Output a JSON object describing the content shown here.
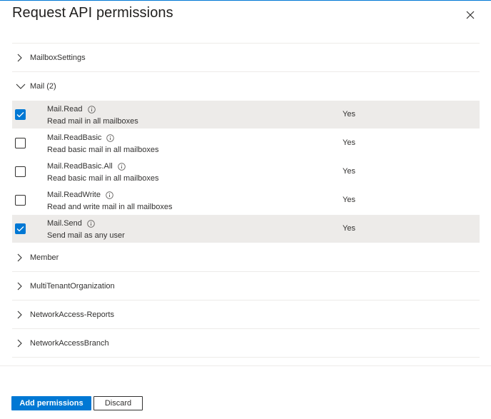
{
  "panel": {
    "title": "Request API permissions",
    "close_icon": "close-icon"
  },
  "groups_before": [
    {
      "label": "MailboxSettings",
      "expanded": false
    }
  ],
  "expanded_group": {
    "label": "Mail (2)",
    "expanded": true,
    "permissions": [
      {
        "name": "Mail.Read",
        "description": "Read mail in all mailboxes",
        "admin_consent": "Yes",
        "checked": true
      },
      {
        "name": "Mail.ReadBasic",
        "description": "Read basic mail in all mailboxes",
        "admin_consent": "Yes",
        "checked": false
      },
      {
        "name": "Mail.ReadBasic.All",
        "description": "Read basic mail in all mailboxes",
        "admin_consent": "Yes",
        "checked": false
      },
      {
        "name": "Mail.ReadWrite",
        "description": "Read and write mail in all mailboxes",
        "admin_consent": "Yes",
        "checked": false
      },
      {
        "name": "Mail.Send",
        "description": "Send mail as any user",
        "admin_consent": "Yes",
        "checked": true
      }
    ]
  },
  "groups_after": [
    {
      "label": "Member",
      "expanded": false
    },
    {
      "label": "MultiTenantOrganization",
      "expanded": false
    },
    {
      "label": "NetworkAccess-Reports",
      "expanded": false
    },
    {
      "label": "NetworkAccessBranch",
      "expanded": false
    }
  ],
  "footer": {
    "primary_label": "Add permissions",
    "secondary_label": "Discard"
  },
  "colors": {
    "accent": "#0078d4",
    "selected_row": "#edebe9"
  }
}
